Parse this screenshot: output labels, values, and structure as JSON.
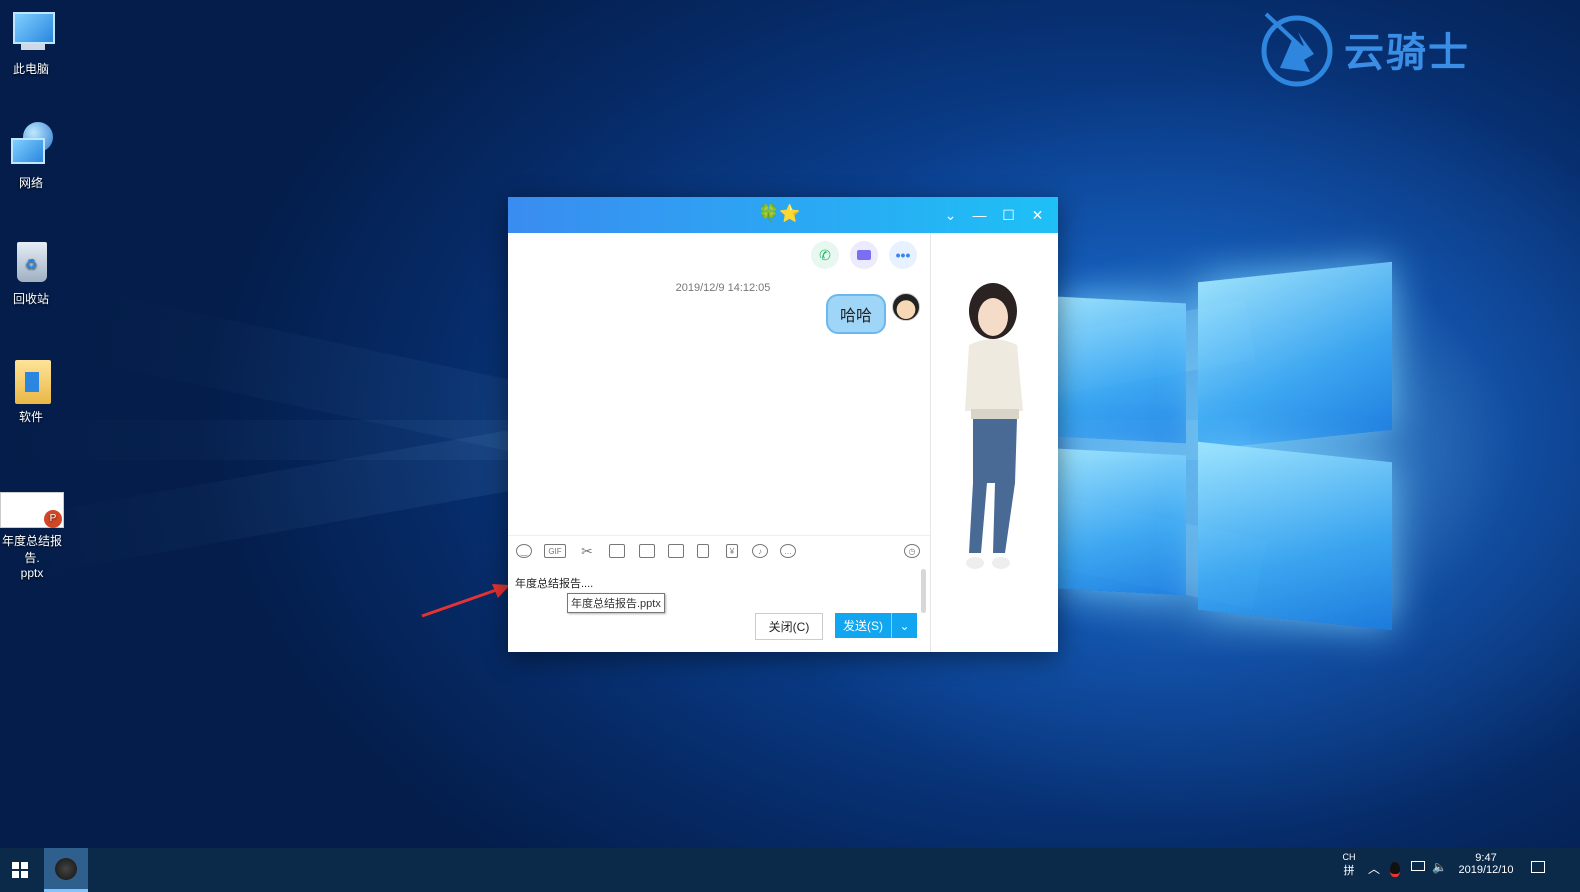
{
  "desktop": {
    "icons": [
      {
        "label": "此电脑"
      },
      {
        "label": "网络"
      },
      {
        "label": "回收站"
      },
      {
        "label": "软件"
      },
      {
        "label": "年度总结报告.\npptx"
      }
    ]
  },
  "watermark": {
    "text": "云骑士"
  },
  "chat": {
    "title_icons": "🍀⭐",
    "timestamp": "2019/12/9 14:12:05",
    "message": "哈哈",
    "input_text": "年度总结报告....",
    "tooltip": "年度总结报告.pptx",
    "close_button": "关闭(C)",
    "send_button": "发送(S)",
    "toolbar_icons": [
      "emoji-icon",
      "gif-icon",
      "screenshot-icon",
      "folder-icon",
      "sticker-icon",
      "image-icon",
      "shake-icon",
      "red-packet-icon",
      "music-icon",
      "more-icon"
    ]
  },
  "taskbar": {
    "ime_top": "CH",
    "ime_bottom": "拼",
    "time": "9:47",
    "date": "2019/12/10"
  },
  "colors": {
    "titlebar_start": "#3a8cf0",
    "titlebar_end": "#1ec0f6",
    "send_button": "#12a6f0",
    "taskbar": "#0b2a4a"
  }
}
